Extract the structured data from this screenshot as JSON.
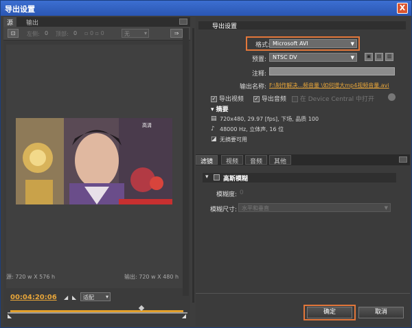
{
  "window": {
    "title": "导出设置",
    "close": "X"
  },
  "left": {
    "tabs": [
      "源",
      "输出"
    ],
    "toolbar": {
      "crop": "⊡",
      "left_label": "左侧:",
      "left_val": "0",
      "top_label": "顶部:",
      "top_val": "0",
      "mode": "无",
      "export": "⇒"
    },
    "source_info": "源: 720 w X 576 h",
    "output_info": "输出: 720 w X 480 h",
    "timecode": "00:04:20:06",
    "fit": "适配"
  },
  "right": {
    "section_title": "导出设置",
    "format_label": "格式:",
    "format_value": "Microsoft AVI",
    "preset_label": "预置:",
    "preset_value": "NTSC DV",
    "comment_label": "注释:",
    "output_name_label": "输出名称:",
    "output_name_value": "F:\\制作解决...频音量 \\如何增大mp4视频音量.avi",
    "export_video": "导出视频",
    "export_audio": "导出音频",
    "device_central": "在 Device Central 中打开",
    "summary_title": "摘要",
    "summary_video": "720x480, 29.97 [fps], 下场, 品质 100",
    "summary_audio": "48000 Hz, 立体声, 16 位",
    "summary_none": "无摘要可用",
    "tabs": [
      "滤镜",
      "视频",
      "音频",
      "其他"
    ],
    "filter_title": "高斯模糊",
    "blur_label": "模糊度:",
    "blur_value": "0",
    "blur_dim_label": "模糊尺寸:",
    "blur_dim_value": "水平和垂直",
    "ok": "确定",
    "cancel": "取消"
  },
  "video_overlay": {
    "corner": "高清"
  }
}
